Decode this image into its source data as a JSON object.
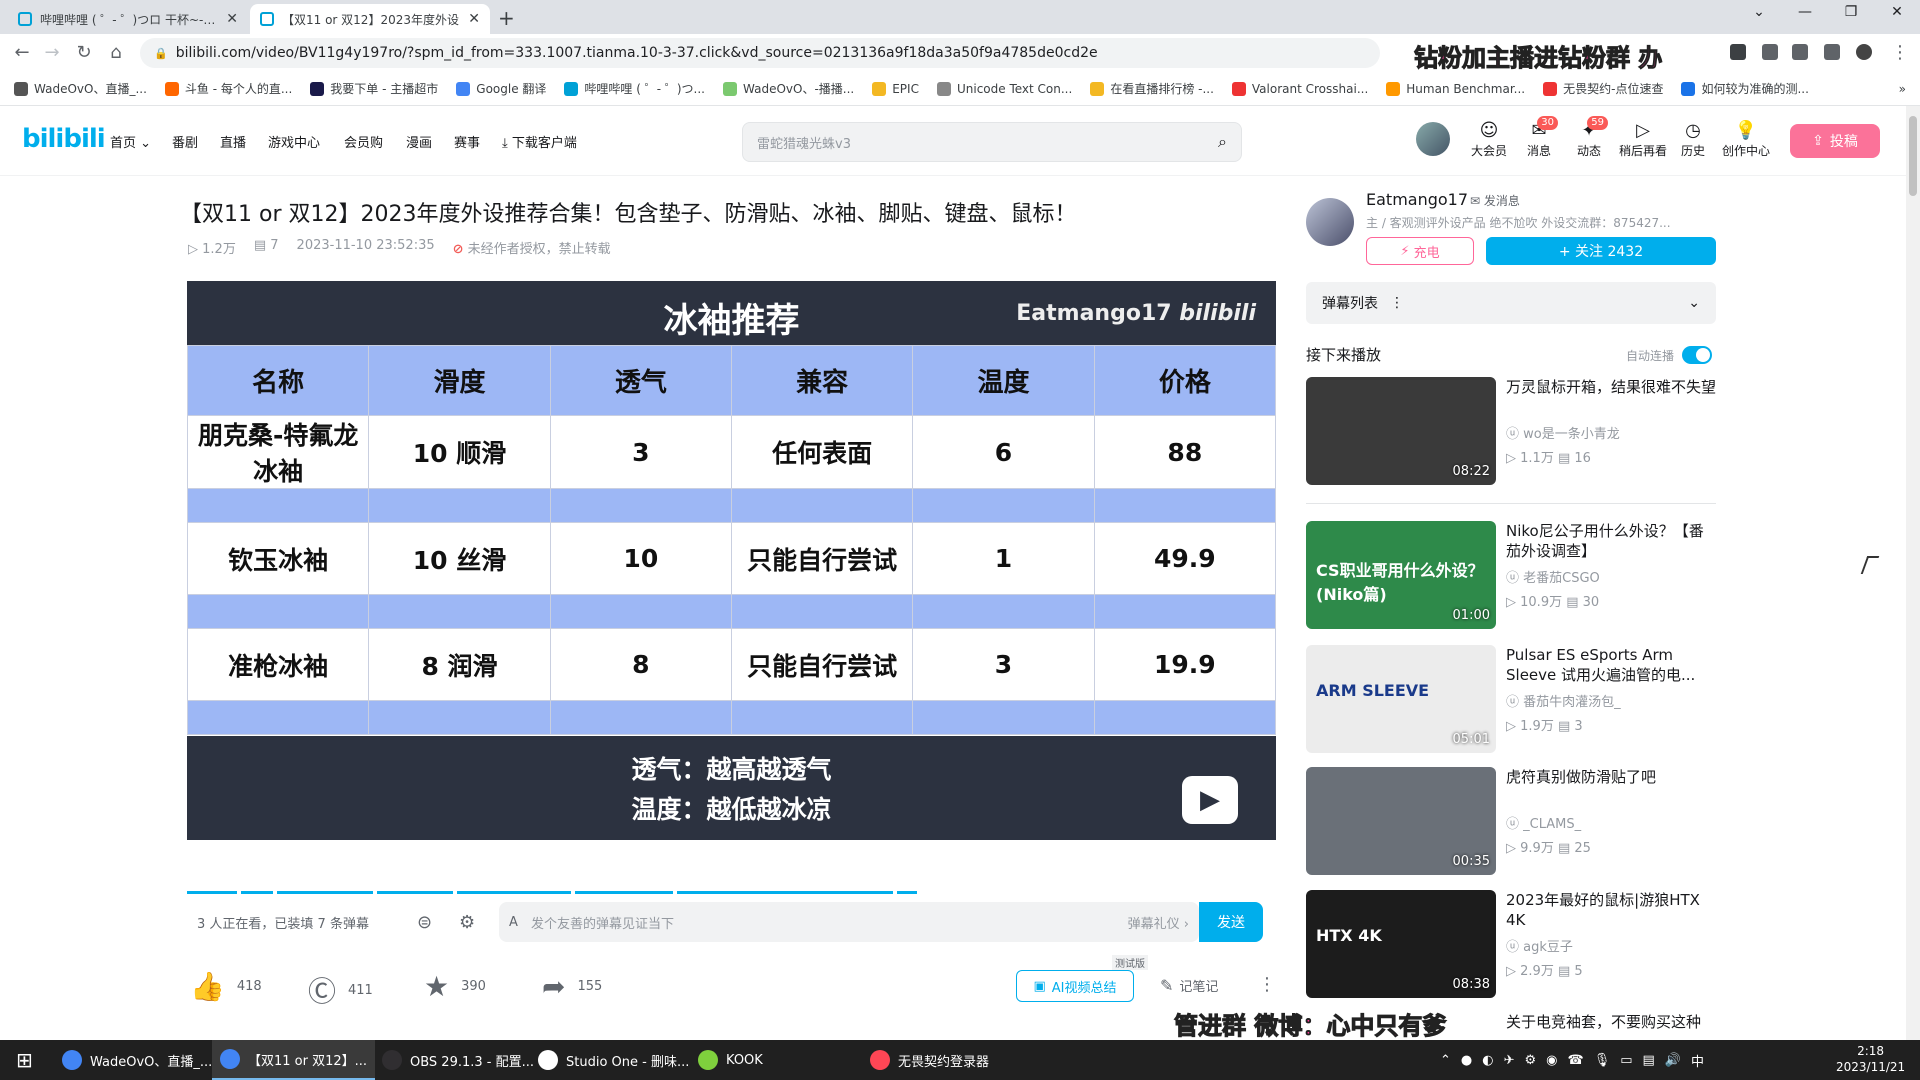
{
  "browser": {
    "tabs": [
      {
        "label": "哔哩哔哩 ( ゜- ゜)つロ 干杯~-bili",
        "active": false
      },
      {
        "label": "【双11 or 双12】2023年度外设",
        "active": true
      }
    ],
    "url": "bilibili.com/video/BV11g4y197ro/?spm_id_from=333.1007.tianma.10-3-37.click&vd_source=0213136a9f18da3a50f9a4785de0cd2e",
    "overlay_top": "钻粉加主播进钻粉群  办",
    "overlay_bottom": "管进群   微博：心中只有爹",
    "bookmarks": [
      "WadeOvO、直播_...",
      "斗鱼 - 每个人的直...",
      "我要下单 - 主播超市",
      "Google 翻译",
      "哔哩哔哩 ( ゜- ゜)つ...",
      "WadeOvO、-播播...",
      "EPIC",
      "Unicode Text Con...",
      "在看直播排行榜 -...",
      "Valorant Crosshai...",
      "Human Benchmar...",
      "无畏契约-点位速查",
      "如何较为准确的测..."
    ],
    "bookmarks_more": "»"
  },
  "site": {
    "logo": "bilibili",
    "nav": [
      "首页",
      "番剧",
      "直播",
      "游戏中心",
      "会员购",
      "漫画",
      "赛事",
      "下载客户端"
    ],
    "search_placeholder": "雷蛇猎魂光蛛v3",
    "icons": [
      {
        "label": "大会员",
        "badge": ""
      },
      {
        "label": "消息",
        "badge": "30"
      },
      {
        "label": "动态",
        "badge": "59"
      },
      {
        "label": "稍后再看",
        "badge": ""
      },
      {
        "label": "历史",
        "badge": ""
      },
      {
        "label": "创作中心",
        "badge": ""
      }
    ],
    "upload_label": "投稿"
  },
  "video": {
    "title": "【双11 or 双12】2023年度外设推荐合集！包含垫子、防滑贴、冰袖、脚贴、键盘、鼠标！",
    "views": "1.2万",
    "danmaku": "7",
    "date": "2023-11-10 23:52:35",
    "notice": "未经作者授权，禁止转载"
  },
  "player": {
    "heading": "冰袖推荐",
    "watermark": "Eatmango17",
    "watermark_brand": "bilibili",
    "columns": [
      "名称",
      "滑度",
      "透气",
      "兼容",
      "温度",
      "价格"
    ],
    "rows": [
      [
        "朋克桑-特氟龙冰袖",
        "10 顺滑",
        "3",
        "任何表面",
        "6",
        "88"
      ],
      [
        "钦玉冰袖",
        "10 丝滑",
        "10",
        "只能自行尝试",
        "1",
        "49.9"
      ],
      [
        "准枪冰袖",
        "8 润滑",
        "8",
        "只能自行尝试",
        "3",
        "19.9"
      ]
    ],
    "notes": [
      "透气：越高越透气",
      "温度：越低越冰凉"
    ]
  },
  "danmaku_bar": {
    "status": "3 人正在看，已装填 7 条弹幕",
    "placeholder": "发个友善的弹幕见证当下",
    "etiquette": "弹幕礼仪 ›",
    "send": "发送"
  },
  "actions": {
    "like": "418",
    "coin": "411",
    "fav": "390",
    "share": "155",
    "ai_summary": "AI视频总结",
    "beta": "测试版",
    "notes": "记笔记"
  },
  "uploader": {
    "name": "Eatmango17",
    "message": "发消息",
    "desc": "主 / 客观测评外设产品 绝不尬吹 外设交流群：875427...",
    "charge": "充电",
    "follow": "+ 关注 2432"
  },
  "sidebar": {
    "danmaku_list": "弹幕列表",
    "next_up": "接下来播放",
    "autoplay": "自动连播",
    "recommendations": [
      {
        "title": "万灵鼠标开箱，结果很难不失望",
        "author": "wo是一条小青龙",
        "views": "1.1万",
        "danmaku": "16",
        "duration": "08:22",
        "thumb_color": "#3a3a3a"
      },
      {
        "title": "Niko尼公子用什么外设？【番茄外设调查】",
        "author": "老番茄CSGO",
        "views": "10.9万",
        "danmaku": "30",
        "duration": "01:00",
        "thumb_color": "#2e8a4a",
        "thumb_caption": "CS职业哥用什么外设？(Niko篇)"
      },
      {
        "title": "Pulsar ES eSports Arm Sleeve 试用火遍油管的电...",
        "author": "番茄牛肉灌汤包_",
        "views": "1.9万",
        "danmaku": "3",
        "duration": "05:01",
        "thumb_color": "#ececec",
        "thumb_caption": "ARM SLEEVE"
      },
      {
        "title": "虎符真别做防滑贴了吧",
        "author": "_CLAMS_",
        "views": "9.9万",
        "danmaku": "25",
        "duration": "00:35",
        "thumb_color": "#6a7078"
      },
      {
        "title": "2023年最好的鼠标|游狼HTX 4K",
        "author": "agk豆子",
        "views": "2.9万",
        "danmaku": "5",
        "duration": "08:38",
        "thumb_color": "#1c1c1c",
        "thumb_caption": "HTX 4K"
      },
      {
        "title": "关于电竞袖套，不要购买这种",
        "author": "",
        "views": "",
        "danmaku": "",
        "duration": "",
        "thumb_color": "#ffffff"
      }
    ]
  },
  "taskbar": {
    "items": [
      {
        "label": "WadeOvO、直播_...",
        "color": "#4285f4"
      },
      {
        "label": "【双11 or 双12】...",
        "color": "#4285f4"
      },
      {
        "label": "OBS 29.1.3 - 配置...",
        "color": "#302e31"
      },
      {
        "label": "Studio One - 删味...",
        "color": "#ffffff"
      },
      {
        "label": "KOOK",
        "color": "#7fd03d"
      },
      {
        "label": "无畏契约登录器",
        "color": "#ff4655"
      }
    ],
    "ime": "中",
    "time": "2:18",
    "date": "2023/11/21"
  }
}
